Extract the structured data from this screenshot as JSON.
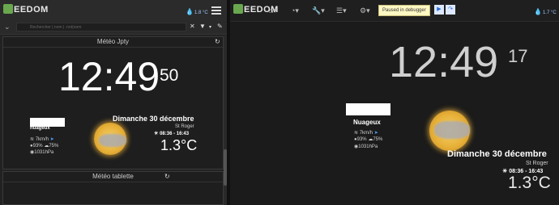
{
  "left_nav": {
    "logo": "EEDOM",
    "temperature": "1.8 °C"
  },
  "search": {
    "placeholder": "Rechercher | nom | :not(nom"
  },
  "widget1": {
    "title": "Météo Jpty",
    "clock": "12:49",
    "seconds": "50",
    "condition": "nuageux",
    "wind": "7km/h",
    "humidity": "93%",
    "rain": "75%",
    "pressure": "1031hPa",
    "date": "Dimanche 30 décembre",
    "saint": "St Roger",
    "sun_times": "08:36 - 16:43",
    "temperature": "1.3°C"
  },
  "widget2": {
    "title": "Météo tablette"
  },
  "right_nav": {
    "logo": "EEDOM",
    "debugger": "Paused in debugger",
    "temperature": "1.7 °C"
  },
  "right_widget": {
    "clock": "12:49",
    "seconds": "17",
    "condition": "Nuageux",
    "wind": "7km/h",
    "humidity": "93%",
    "rain": "75%",
    "pressure": "1031hPa",
    "date": "Dimanche 30 décembre",
    "saint": "St Roger",
    "sun_times": "08:36 - 16:43",
    "temperature": "1.3°C"
  },
  "icons": [
    "house-icon",
    "droplet-icon",
    "hamburger-icon",
    "chevron-icon",
    "filter-icon",
    "pencil-icon",
    "close-icon",
    "refresh-icon",
    "wind-icon",
    "humidity-icon",
    "rain-icon",
    "pressure-icon",
    "sun-icon",
    "home-icon",
    "tachometer-icon",
    "wrench-icon",
    "list-icon",
    "gear-icon",
    "play-icon",
    "step-over-icon"
  ]
}
